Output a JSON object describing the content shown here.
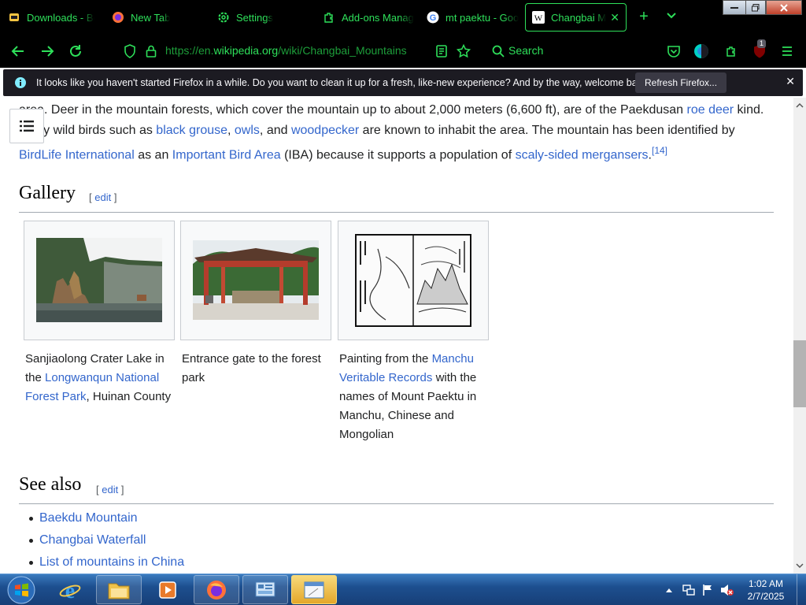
{
  "browser": {
    "tabs": [
      {
        "title": "Downloads - Bo",
        "icon": "downloads-icon",
        "active": false
      },
      {
        "title": "New Tab",
        "icon": "firefox-icon",
        "active": false
      },
      {
        "title": "Settings",
        "icon": "gear-icon",
        "active": false
      },
      {
        "title": "Add-ons Manag",
        "icon": "puzzle-icon",
        "active": false
      },
      {
        "title": "mt paektu - Goo",
        "icon": "google-icon",
        "active": false
      },
      {
        "title": "Changbai M",
        "icon": "wikipedia-icon",
        "active": true
      }
    ],
    "url_prefix": "https://en.",
    "url_domain": "wikipedia.org",
    "url_path": "/wiki/Changbai_Mountains",
    "search_label": "Search",
    "extension_badge": "1",
    "accent_color": "#2ee05a"
  },
  "notification": {
    "message": "It looks like you haven't started Firefox in a while. Do you want to clean it up for a fresh, like-new experience? And by the way, welcome back!",
    "button": "Refresh Firefox..."
  },
  "article": {
    "p1": {
      "t1": "area. Deer in the mountain forests, which cover the mountain up to about 2,000 meters (6,600 ft), are of the Paekdusan ",
      "l1": "roe deer",
      "t2": " kind.",
      "t3": "Many wild birds such as ",
      "l2": "black grouse",
      "t4": ", ",
      "l3": "owls",
      "t5": ", and ",
      "l4": "woodpecker",
      "t6": " are known to inhabit the area. The mountain has been identified by",
      "l5": "BirdLife International",
      "t7": " as an ",
      "l6": "Important Bird Area",
      "t8": " (IBA) because it supports a population of ",
      "l7": "scaly-sided mergansers",
      "t9": ".",
      "ref": "[14]"
    },
    "gallery": {
      "heading": "Gallery",
      "edit_open": "[ ",
      "edit": "edit",
      "edit_close": " ]",
      "items": [
        {
          "c1": "Sanjiaolong Crater Lake in the ",
          "link": "Longwanqun National Forest Park",
          "c2": ", Huinan County"
        },
        {
          "c1": "Entrance gate to the forest park"
        },
        {
          "c1": "Painting from the ",
          "link": "Manchu Veritable Records",
          "c2": " with the names of Mount Paektu in Manchu, Chinese and Mongolian"
        }
      ]
    },
    "see_also": {
      "heading": "See also",
      "edit_open": "[ ",
      "edit": "edit",
      "edit_close": " ]",
      "items": [
        "Baekdu Mountain",
        "Changbai Waterfall",
        "List of mountains in China"
      ]
    }
  },
  "taskbar": {
    "time": "1:02 AM",
    "date": "2/7/2025"
  }
}
